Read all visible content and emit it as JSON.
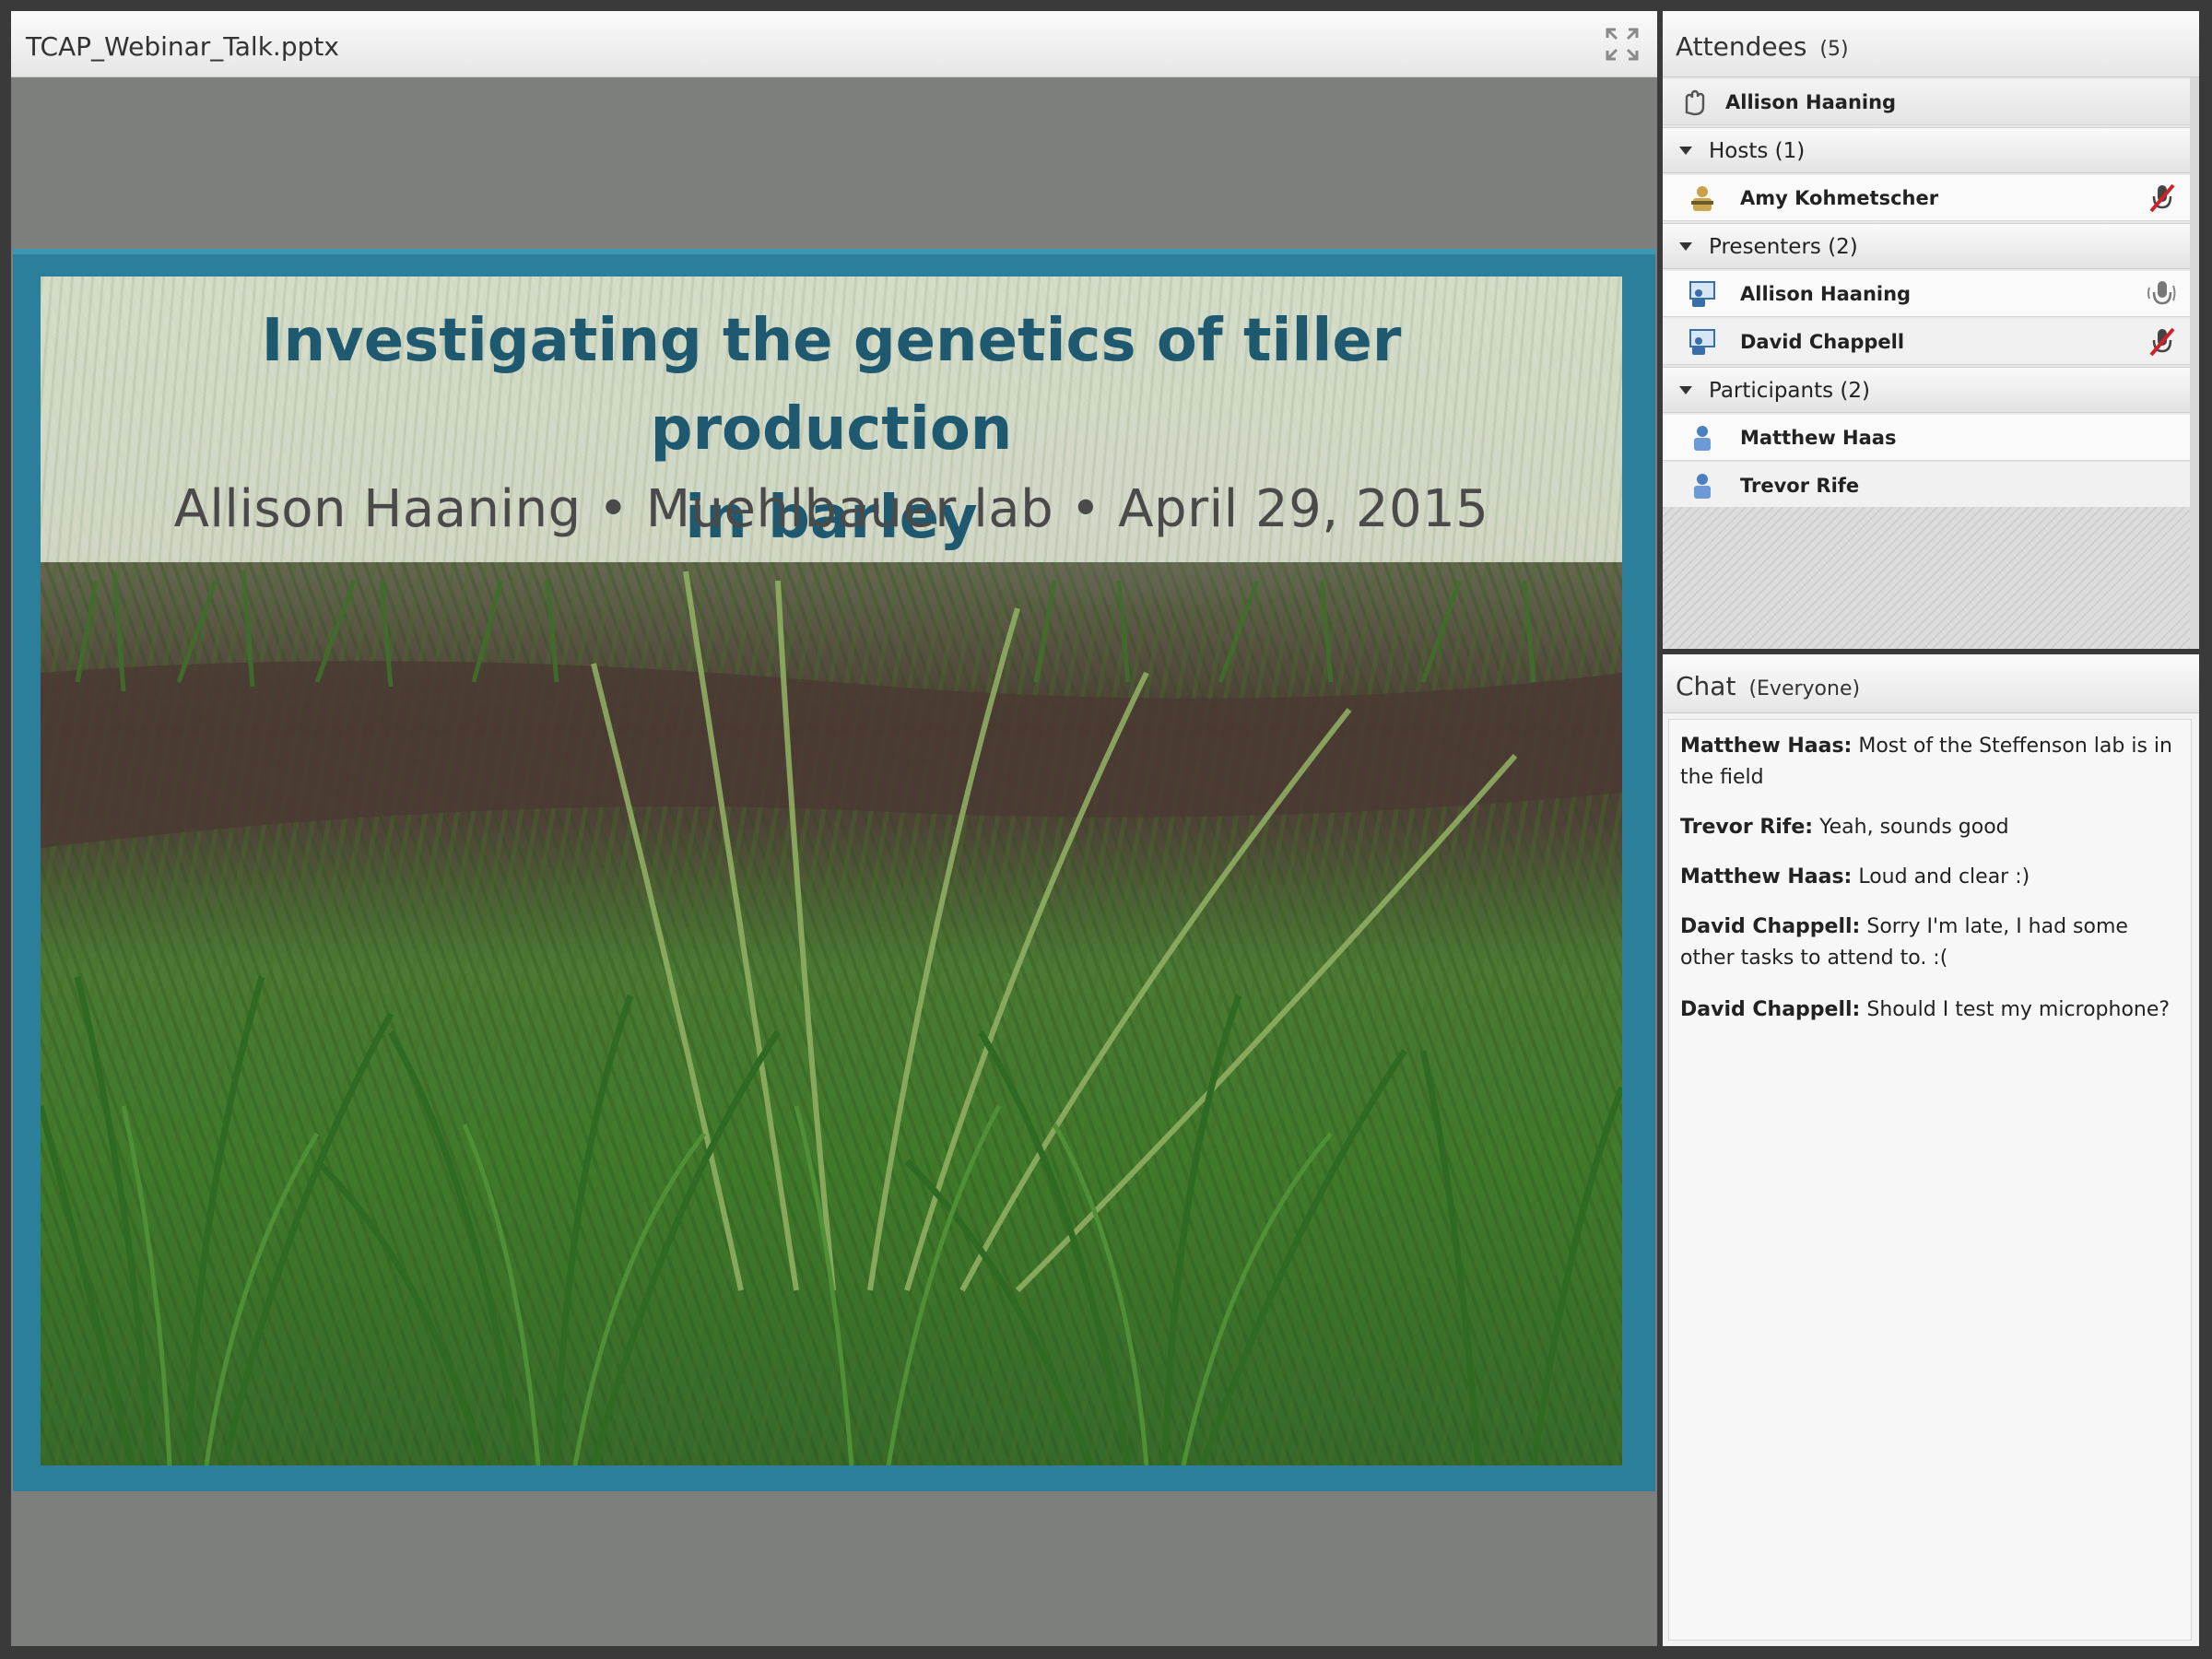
{
  "share": {
    "title": "TCAP_Webinar_Talk.pptx",
    "slide": {
      "title_line1": "Investigating the genetics of tiller production",
      "title_line2": "in barley",
      "subtitle": "Allison Haaning • Muehlbauer lab • April 29, 2015"
    }
  },
  "attendees": {
    "title": "Attendees",
    "count": "(5)",
    "me": "Allison Haaning",
    "groups": [
      {
        "label": "Hosts (1)",
        "members": [
          "Amy Kohmetscher"
        ]
      },
      {
        "label": "Presenters (2)",
        "members": [
          "Allison Haaning",
          "David Chappell"
        ]
      },
      {
        "label": "Participants (2)",
        "members": [
          "Matthew Haas",
          "Trevor Rife"
        ]
      }
    ]
  },
  "chat": {
    "title": "Chat",
    "scope": "(Everyone)",
    "messages": [
      {
        "author": "Matthew Haas:",
        "text": " Most of the Steffenson lab is in the field"
      },
      {
        "author": "Trevor Rife:",
        "text": " Yeah, sounds good"
      },
      {
        "author": "Matthew Haas:",
        "text": " Loud and clear :)"
      },
      {
        "author": "David Chappell:",
        "text": " Sorry I'm late, I had some other tasks to attend to. :("
      },
      {
        "author": "David Chappell:",
        "text": " Should I test my microphone?"
      }
    ]
  },
  "icons": {
    "fullscreen": "fullscreen-icon",
    "host": "host-icon",
    "presenter": "presenter-icon",
    "participant": "participant-icon",
    "mic_off": "microphone-off-icon",
    "mic_on": "microphone-on-icon"
  }
}
